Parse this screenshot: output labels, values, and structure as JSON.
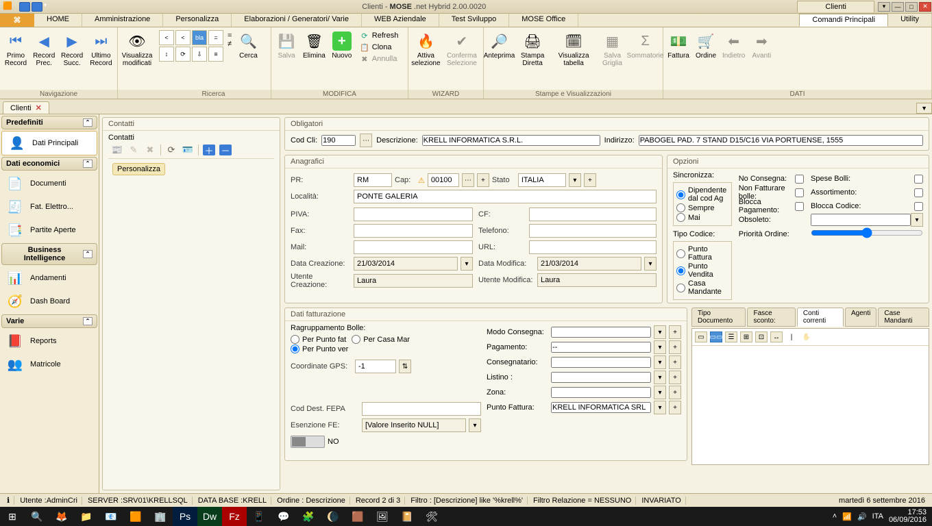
{
  "title": {
    "pre": "Clienti - ",
    "app": "MOSE",
    "post": " .net Hybrid 2.00.0020",
    "rightTab": "Clienti"
  },
  "menu": [
    "HOME",
    "Amministrazione",
    "Personalizza",
    "Elaborazioni / Generatori/ Varie",
    "WEB Aziendale",
    "Test Sviluppo",
    "MOSE Office"
  ],
  "menuRight": [
    "Comandi Principali",
    "Utility"
  ],
  "ribbon": {
    "nav": {
      "primo": "Primo Record",
      "prec": "Record Prec.",
      "succ": "Record Succ.",
      "ultimo": "Ultimo Record",
      "label": "Navigazione"
    },
    "vis": {
      "btn": "Visualizza modificati"
    },
    "ricerca": {
      "cerca": "Cerca",
      "label": "Ricerca"
    },
    "mod": {
      "refresh": "Refresh",
      "clona": "Clona",
      "annulla": "Annulla",
      "salva": "Salva",
      "elimina": "Elimina",
      "nuovo": "Nuovo",
      "label": "MODIFICA"
    },
    "wiz": {
      "attiva": "Attiva selezione",
      "conferma": "Conferma Selezione",
      "label": "WIZARD"
    },
    "stampe": {
      "anteprima": "Anteprima",
      "stampa": "Stampa Diretta",
      "vistab": "Visualizza tabella",
      "salvagr": "Salva Griglia",
      "somm": "Sommatorie",
      "label": "Stampe e Visualizzazioni"
    },
    "dati": {
      "fattura": "Fattura",
      "ordine": "Ordine",
      "indietro": "Indietro",
      "avanti": "Avanti",
      "label": "DATI"
    }
  },
  "docTab": "Clienti",
  "sidebar": {
    "s1": {
      "title": "Predefiniti",
      "i1": "Dati Principali"
    },
    "s2": {
      "title": "Dati economici",
      "i1": "Documenti",
      "i2": "Fat. Elettro...",
      "i3": "Partite Aperte"
    },
    "s3": {
      "title": "Business Intelligence",
      "i1": "Andamenti",
      "i2": "Dash Board"
    },
    "s4": {
      "title": "Varie",
      "i1": "Reports",
      "i2": "Matricole"
    }
  },
  "contatti": {
    "title1": "Contatti",
    "title2": "Contatti",
    "pers": "Personalizza"
  },
  "oblig": {
    "title": "Obligatori",
    "codcli_l": "Cod Cli:",
    "codcli": "190",
    "descr_l": "Descrizione:",
    "descr": "KRELL INFORMATICA S.R.L.",
    "indir_l": "Indirizzo:",
    "indir": "PABOGEL PAD. 7 STAND D15/C16 VIA PORTUENSE, 1555"
  },
  "anag": {
    "title": "Anagrafici",
    "pr_l": "PR:",
    "pr": "RM",
    "cap_l": "Cap:",
    "cap": "00100",
    "stato_l": "Stato",
    "stato": "ITALIA",
    "loc_l": "Località:",
    "loc": "PONTE GALERIA",
    "piva_l": "PIVA:",
    "piva": "",
    "cf_l": "CF:",
    "cf": "",
    "fax_l": "Fax:",
    "fax": "",
    "tel_l": "Telefono:",
    "tel": "",
    "mail_l": "Mail:",
    "mail": "",
    "url_l": "URL:",
    "url": "",
    "dc_l": "Data Creazione:",
    "dc": "21/03/2014",
    "dm_l": "Data Modifica:",
    "dm": "21/03/2014",
    "uc_l": "Utente Creazione:",
    "uc": "Laura",
    "um_l": "Utente Modifica:",
    "um": "Laura"
  },
  "opzioni": {
    "title": "Opzioni",
    "sinc_l": "Sincronizza:",
    "sinc1": "Dipendente dal cod Ag",
    "sinc2": "Sempre",
    "sinc3": "Mai",
    "tipo_l": "Tipo Codice:",
    "t1": "Punto Fattura",
    "t2": "Punto Vendita",
    "t3": "Casa Mandante",
    "noCons": "No Consegna:",
    "spese": "Spese Bolli:",
    "nonFat": "Non Fatturare bolle:",
    "assort": "Assortimento:",
    "blocPag": "Blocca Pagamento:",
    "blocCod": "Blocca Codice:",
    "obs_l": "Obsoleto:",
    "prio_l": "Priorità Ordine:"
  },
  "fatt": {
    "title": "Dati fatturazione",
    "rag_l": "Ragruppamento Bolle:",
    "r1": "Per Punto fat",
    "r2": "Per Casa Mar",
    "r3": "Per Punto ver",
    "gps_l": "Coordinate GPS:",
    "gps": "-1",
    "modo_l": "Modo Consegna:",
    "pag_l": "Pagamento:",
    "pag": "--",
    "cons_l": "Consegnatario:",
    "list_l": "Listino :",
    "zona_l": "Zona:",
    "pf_l": "Punto Fattura:",
    "pf": "KRELL INFORMATICA SRL",
    "cdf_l": "Cod Dest. FEPA",
    "esfe_l": "Esenzione FE:",
    "esfe": "[Valore Inserito NULL]",
    "no": "NO"
  },
  "subtabs": [
    "Tipo Documento",
    "Fasce sconto:",
    "Conti correnti",
    "Agenti",
    "Case Mandanti"
  ],
  "status": {
    "utente": "Utente :AdminCri",
    "server": "SERVER :SRV01\\KRELLSQL",
    "db": "DATA BASE :KRELL",
    "ordine": "Ordine : Descrizione",
    "record": "Record 2 di 3",
    "filtro": "Filtro :   [Descrizione] like '%krell%'",
    "filtrorel": "Filtro Relazione = NESSUNO",
    "inv": "INVARIATO",
    "date": "martedì 6 settembre 2016"
  },
  "taskbar": {
    "lang": "ITA",
    "time": "17:53",
    "tdate": "06/09/2016"
  }
}
